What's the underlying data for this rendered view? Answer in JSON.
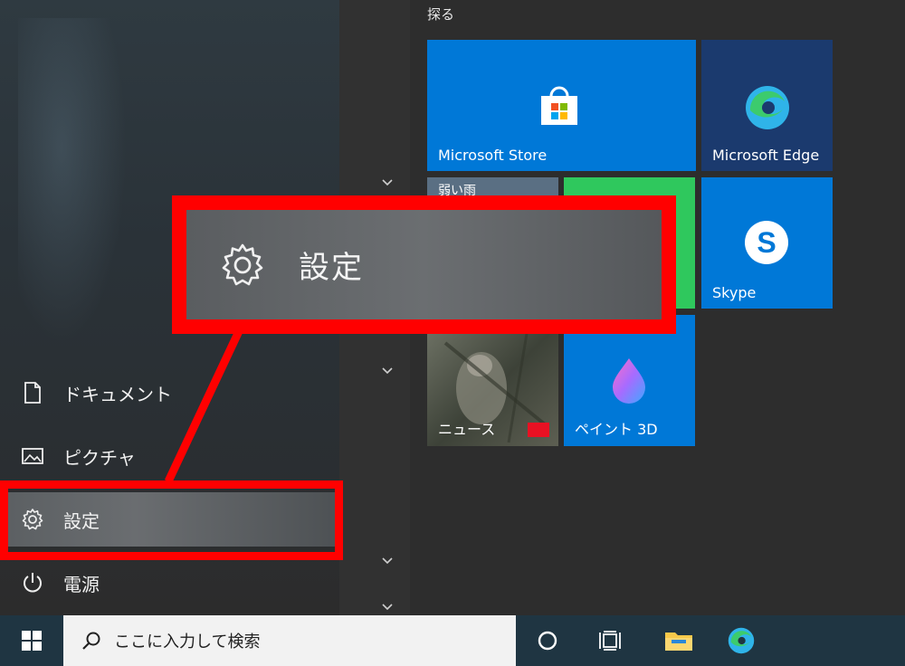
{
  "start_menu": {
    "nav_items": [
      {
        "label": "ドキュメント",
        "icon": "document-icon"
      },
      {
        "label": "ピクチャ",
        "icon": "picture-icon"
      },
      {
        "label": "設定",
        "icon": "gear-icon",
        "active": true
      },
      {
        "label": "電源",
        "icon": "power-icon"
      }
    ],
    "group_label": "探る",
    "tiles": [
      {
        "label": "Microsoft Store",
        "color": "#0078d7",
        "icon": "store-icon"
      },
      {
        "label": "Microsoft Edge",
        "color": "#1b3a6e",
        "icon": "edge-icon"
      },
      {
        "label": "弱い雨",
        "color": "#5a6f83",
        "icon": "weather-tile"
      },
      {
        "label": "",
        "color": "#2fc85d",
        "icon": "green-tile"
      },
      {
        "label": "Skype",
        "color": "#0078d7",
        "icon": "skype-icon"
      },
      {
        "label": "ニュース",
        "color": "#4f5348",
        "icon": "news-icon"
      },
      {
        "label": "ペイント 3D",
        "color": "#0078d7",
        "icon": "paint3d-icon"
      }
    ]
  },
  "callout": {
    "label": "設定",
    "icon": "gear-icon"
  },
  "taskbar": {
    "search_placeholder": "ここに入力して検索",
    "icons": [
      "windows-icon",
      "search-icon",
      "cortana-icon",
      "task-view-icon",
      "file-explorer-icon",
      "edge-icon"
    ]
  },
  "colors": {
    "highlight": "#ff0000",
    "accent": "#0078d7"
  }
}
